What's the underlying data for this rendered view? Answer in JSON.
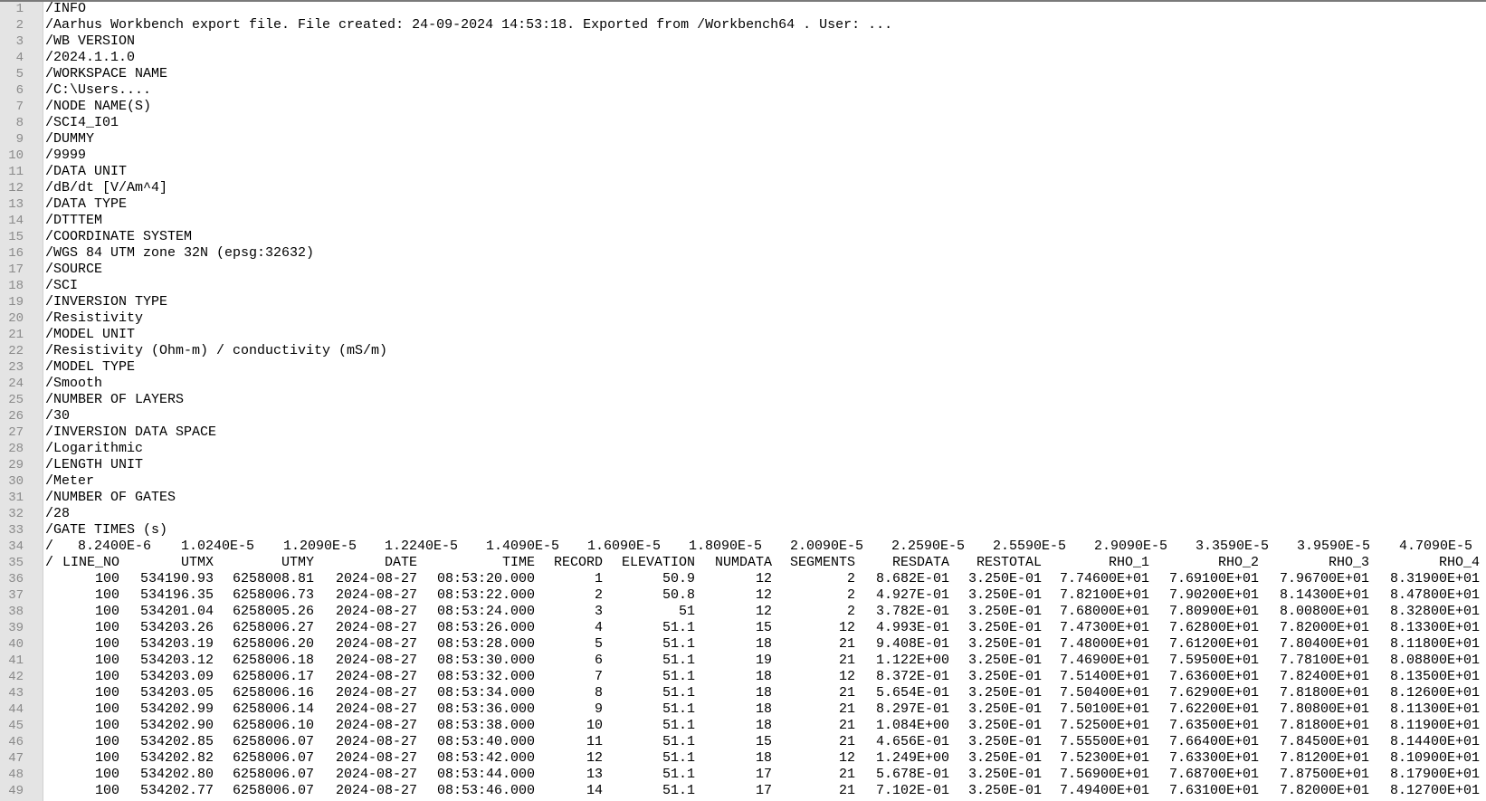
{
  "header_lines": [
    {
      "num": "1",
      "text": "/INFO"
    },
    {
      "num": "2",
      "text": "/Aarhus Workbench export file. File created: 24-09-2024 14:53:18. Exported from /Workbench64 . User: ..."
    },
    {
      "num": "3",
      "text": "/WB VERSION"
    },
    {
      "num": "4",
      "text": "/2024.1.1.0"
    },
    {
      "num": "5",
      "text": "/WORKSPACE NAME"
    },
    {
      "num": "6",
      "text": "/C:\\Users...."
    },
    {
      "num": "7",
      "text": "/NODE NAME(S)"
    },
    {
      "num": "8",
      "text": "/SCI4_I01"
    },
    {
      "num": "9",
      "text": "/DUMMY"
    },
    {
      "num": "10",
      "text": "/9999"
    },
    {
      "num": "11",
      "text": "/DATA UNIT"
    },
    {
      "num": "12",
      "text": "/dB/dt [V/Am^4]"
    },
    {
      "num": "13",
      "text": "/DATA TYPE"
    },
    {
      "num": "14",
      "text": "/DTTTEM"
    },
    {
      "num": "15",
      "text": "/COORDINATE SYSTEM"
    },
    {
      "num": "16",
      "text": "/WGS 84 UTM zone 32N (epsg:32632)"
    },
    {
      "num": "17",
      "text": "/SOURCE"
    },
    {
      "num": "18",
      "text": "/SCI"
    },
    {
      "num": "19",
      "text": "/INVERSION TYPE"
    },
    {
      "num": "20",
      "text": "/Resistivity"
    },
    {
      "num": "21",
      "text": "/MODEL UNIT"
    },
    {
      "num": "22",
      "text": "/Resistivity (Ohm-m) / conductivity (mS/m)"
    },
    {
      "num": "23",
      "text": "/MODEL TYPE"
    },
    {
      "num": "24",
      "text": "/Smooth"
    },
    {
      "num": "25",
      "text": "/NUMBER OF LAYERS"
    },
    {
      "num": "26",
      "text": "/30"
    },
    {
      "num": "27",
      "text": "/INVERSION DATA SPACE"
    },
    {
      "num": "28",
      "text": "/Logarithmic"
    },
    {
      "num": "29",
      "text": "/LENGTH UNIT"
    },
    {
      "num": "30",
      "text": "/Meter"
    },
    {
      "num": "31",
      "text": "/NUMBER OF GATES"
    },
    {
      "num": "32",
      "text": "/28"
    },
    {
      "num": "33",
      "text": "/GATE TIMES (s)"
    }
  ],
  "gate_line": {
    "num": "34",
    "prefix": "/",
    "values": [
      "8.2400E-6",
      "1.0240E-5",
      "1.2090E-5",
      "1.2240E-5",
      "1.4090E-5",
      "1.6090E-5",
      "1.8090E-5",
      "2.0090E-5",
      "2.2590E-5",
      "2.5590E-5",
      "2.9090E-5",
      "3.3590E-5",
      "3.9590E-5",
      "4.7090E-5"
    ]
  },
  "column_header": {
    "num": "35",
    "prefix": "/",
    "columns": [
      "LINE_NO",
      "UTMX",
      "UTMY",
      "DATE",
      "TIME",
      "RECORD",
      "ELEVATION",
      "NUMDATA",
      "SEGMENTS",
      "RESDATA",
      "RESTOTAL",
      "RHO_1",
      "RHO_2",
      "RHO_3",
      "RHO_4"
    ]
  },
  "rows": [
    {
      "num": "36",
      "cells": [
        "100",
        "534190.93",
        "6258008.81",
        "2024-08-27",
        "08:53:20.000",
        "1",
        "50.9",
        "12",
        "2",
        "8.682E-01",
        "3.250E-01",
        "7.74600E+01",
        "7.69100E+01",
        "7.96700E+01",
        "8.31900E+01"
      ]
    },
    {
      "num": "37",
      "cells": [
        "100",
        "534196.35",
        "6258006.73",
        "2024-08-27",
        "08:53:22.000",
        "2",
        "50.8",
        "12",
        "2",
        "4.927E-01",
        "3.250E-01",
        "7.82100E+01",
        "7.90200E+01",
        "8.14300E+01",
        "8.47800E+01"
      ]
    },
    {
      "num": "38",
      "cells": [
        "100",
        "534201.04",
        "6258005.26",
        "2024-08-27",
        "08:53:24.000",
        "3",
        "51",
        "12",
        "2",
        "3.782E-01",
        "3.250E-01",
        "7.68000E+01",
        "7.80900E+01",
        "8.00800E+01",
        "8.32800E+01"
      ]
    },
    {
      "num": "39",
      "cells": [
        "100",
        "534203.26",
        "6258006.27",
        "2024-08-27",
        "08:53:26.000",
        "4",
        "51.1",
        "15",
        "12",
        "4.993E-01",
        "3.250E-01",
        "7.47300E+01",
        "7.62800E+01",
        "7.82000E+01",
        "8.13300E+01"
      ]
    },
    {
      "num": "40",
      "cells": [
        "100",
        "534203.19",
        "6258006.20",
        "2024-08-27",
        "08:53:28.000",
        "5",
        "51.1",
        "18",
        "21",
        "9.408E-01",
        "3.250E-01",
        "7.48000E+01",
        "7.61200E+01",
        "7.80400E+01",
        "8.11800E+01"
      ]
    },
    {
      "num": "41",
      "cells": [
        "100",
        "534203.12",
        "6258006.18",
        "2024-08-27",
        "08:53:30.000",
        "6",
        "51.1",
        "19",
        "21",
        "1.122E+00",
        "3.250E-01",
        "7.46900E+01",
        "7.59500E+01",
        "7.78100E+01",
        "8.08800E+01"
      ]
    },
    {
      "num": "42",
      "cells": [
        "100",
        "534203.09",
        "6258006.17",
        "2024-08-27",
        "08:53:32.000",
        "7",
        "51.1",
        "18",
        "12",
        "8.372E-01",
        "3.250E-01",
        "7.51400E+01",
        "7.63600E+01",
        "7.82400E+01",
        "8.13500E+01"
      ]
    },
    {
      "num": "43",
      "cells": [
        "100",
        "534203.05",
        "6258006.16",
        "2024-08-27",
        "08:53:34.000",
        "8",
        "51.1",
        "18",
        "21",
        "5.654E-01",
        "3.250E-01",
        "7.50400E+01",
        "7.62900E+01",
        "7.81800E+01",
        "8.12600E+01"
      ]
    },
    {
      "num": "44",
      "cells": [
        "100",
        "534202.99",
        "6258006.14",
        "2024-08-27",
        "08:53:36.000",
        "9",
        "51.1",
        "18",
        "21",
        "8.297E-01",
        "3.250E-01",
        "7.50100E+01",
        "7.62200E+01",
        "7.80800E+01",
        "8.11300E+01"
      ]
    },
    {
      "num": "45",
      "cells": [
        "100",
        "534202.90",
        "6258006.10",
        "2024-08-27",
        "08:53:38.000",
        "10",
        "51.1",
        "18",
        "21",
        "1.084E+00",
        "3.250E-01",
        "7.52500E+01",
        "7.63500E+01",
        "7.81800E+01",
        "8.11900E+01"
      ]
    },
    {
      "num": "46",
      "cells": [
        "100",
        "534202.85",
        "6258006.07",
        "2024-08-27",
        "08:53:40.000",
        "11",
        "51.1",
        "15",
        "21",
        "4.656E-01",
        "3.250E-01",
        "7.55500E+01",
        "7.66400E+01",
        "7.84500E+01",
        "8.14400E+01"
      ]
    },
    {
      "num": "47",
      "cells": [
        "100",
        "534202.82",
        "6258006.07",
        "2024-08-27",
        "08:53:42.000",
        "12",
        "51.1",
        "18",
        "12",
        "1.249E+00",
        "3.250E-01",
        "7.52300E+01",
        "7.63300E+01",
        "7.81200E+01",
        "8.10900E+01"
      ]
    },
    {
      "num": "48",
      "cells": [
        "100",
        "534202.80",
        "6258006.07",
        "2024-08-27",
        "08:53:44.000",
        "13",
        "51.1",
        "17",
        "21",
        "5.678E-01",
        "3.250E-01",
        "7.56900E+01",
        "7.68700E+01",
        "7.87500E+01",
        "8.17900E+01"
      ]
    },
    {
      "num": "49",
      "cells": [
        "100",
        "534202.77",
        "6258006.07",
        "2024-08-27",
        "08:53:46.000",
        "14",
        "51.1",
        "17",
        "21",
        "7.102E-01",
        "3.250E-01",
        "7.49400E+01",
        "7.63100E+01",
        "7.82000E+01",
        "8.12700E+01"
      ]
    }
  ]
}
